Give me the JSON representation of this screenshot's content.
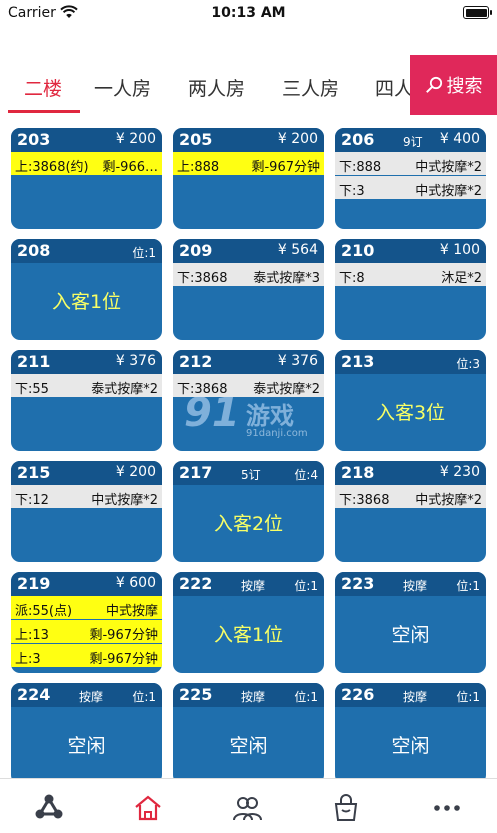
{
  "status_bar": {
    "carrier": "Carrier",
    "time": "10:13 AM"
  },
  "tabs": [
    {
      "label": "二楼",
      "active": true
    },
    {
      "label": "一人房",
      "active": false
    },
    {
      "label": "两人房",
      "active": false
    },
    {
      "label": "三人房",
      "active": false
    },
    {
      "label": "四人",
      "active": false
    }
  ],
  "search": {
    "label": "搜索"
  },
  "rooms": [
    {
      "number": "203",
      "mid": "",
      "right": "¥ 200",
      "lines": [
        {
          "left": "上:3868(约)",
          "right": "剩-966…",
          "bg": "yellow"
        }
      ],
      "center": ""
    },
    {
      "number": "205",
      "mid": "",
      "right": "¥ 200",
      "lines": [
        {
          "left": "上:888",
          "right": "剩-967分钟",
          "bg": "yellow"
        }
      ],
      "center": ""
    },
    {
      "number": "206",
      "mid": "9订",
      "right": "¥ 400",
      "lines": [
        {
          "left": "下:888",
          "right": "中式按摩*2",
          "bg": "gray"
        },
        {
          "left": "下:3",
          "right": "中式按摩*2",
          "bg": "gray"
        }
      ],
      "center": ""
    },
    {
      "number": "208",
      "mid": "",
      "right": "位:1",
      "lines": [],
      "center": "入客1位"
    },
    {
      "number": "209",
      "mid": "",
      "right": "¥ 564",
      "lines": [
        {
          "left": "下:3868",
          "right": "泰式按摩*3",
          "bg": "gray"
        }
      ],
      "center": ""
    },
    {
      "number": "210",
      "mid": "",
      "right": "¥ 100",
      "lines": [
        {
          "left": "下:8",
          "right": "沐足*2",
          "bg": "gray"
        }
      ],
      "center": ""
    },
    {
      "number": "211",
      "mid": "",
      "right": "¥ 376",
      "lines": [
        {
          "left": "下:55",
          "right": "泰式按摩*2",
          "bg": "gray"
        }
      ],
      "center": ""
    },
    {
      "number": "212",
      "mid": "",
      "right": "¥ 376",
      "lines": [
        {
          "left": "下:3868",
          "right": "泰式按摩*2",
          "bg": "gray"
        }
      ],
      "center": ""
    },
    {
      "number": "213",
      "mid": "",
      "right": "位:3",
      "lines": [],
      "center": "入客3位"
    },
    {
      "number": "215",
      "mid": "",
      "right": "¥ 200",
      "lines": [
        {
          "left": "下:12",
          "right": "中式按摩*2",
          "bg": "gray"
        }
      ],
      "center": ""
    },
    {
      "number": "217",
      "mid": "5订",
      "right": "位:4",
      "lines": [],
      "center": "入客2位"
    },
    {
      "number": "218",
      "mid": "",
      "right": "¥ 230",
      "lines": [
        {
          "left": "下:3868",
          "right": "中式按摩*2",
          "bg": "gray"
        }
      ],
      "center": ""
    },
    {
      "number": "219",
      "mid": "",
      "right": "¥ 600",
      "lines": [
        {
          "left": "派:55(点)",
          "right": "中式按摩",
          "bg": "yellow"
        },
        {
          "left": "上:13",
          "right": "剩-967分钟",
          "bg": "yellow"
        },
        {
          "left": "上:3",
          "right": "剩-967分钟",
          "bg": "yellow"
        }
      ],
      "center": ""
    },
    {
      "number": "222",
      "mid": "按摩",
      "right": "位:1",
      "lines": [],
      "center": "入客1位"
    },
    {
      "number": "223",
      "mid": "按摩",
      "right": "位:1",
      "lines": [],
      "center": "空闲"
    },
    {
      "number": "224",
      "mid": "按摩",
      "right": "位:1",
      "lines": [],
      "center": "空闲"
    },
    {
      "number": "225",
      "mid": "按摩",
      "right": "位:1",
      "lines": [],
      "center": "空闲"
    },
    {
      "number": "226",
      "mid": "按摩",
      "right": "位:1",
      "lines": [],
      "center": "空闲"
    }
  ],
  "watermark": {
    "brand": "91",
    "name": "游戏",
    "url": "91danji.com"
  },
  "bottom_nav": [
    {
      "icon": "network-icon",
      "active": false
    },
    {
      "icon": "home-icon",
      "active": true
    },
    {
      "icon": "people-icon",
      "active": false
    },
    {
      "icon": "bag-icon",
      "active": false
    },
    {
      "icon": "more-icon",
      "active": false
    }
  ],
  "colors": {
    "accent": "#e0283f",
    "search_bg": "#e0285a",
    "room_bg": "#1f6fad",
    "room_head": "#14548b",
    "highlight": "#ffff12",
    "occupied_text": "#f8ff66"
  }
}
